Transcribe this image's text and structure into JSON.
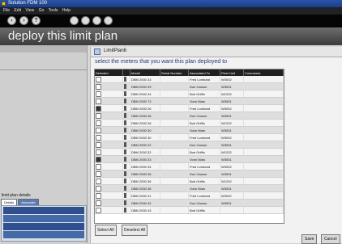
{
  "app": {
    "title": "Solution FDM 100"
  },
  "menu": {
    "items": [
      "File",
      "Edit",
      "View",
      "Go",
      "Tools",
      "Help"
    ]
  },
  "toolbar": {
    "buttons": [
      "back",
      "forward",
      "help",
      "b1",
      "b2",
      "b3",
      "b4"
    ]
  },
  "banner": {
    "title": "deploy this limit plan"
  },
  "dialog": {
    "title": "LimitPlan6",
    "instruction": "select the meters that you want this plan deployed to"
  },
  "table": {
    "headers": [
      "Selected",
      "",
      "Model",
      "Serial Number",
      "Associated To",
      "Fleet Unit",
      "Comments"
    ],
    "rows": [
      {
        "model": "DBM 2000 33",
        "serial": "",
        "assoc": "Fred Lombard",
        "fleet": "W3002",
        "checked": false
      },
      {
        "model": "DBM 2000 33",
        "serial": "",
        "assoc": "Don Carson",
        "fleet": "W3001",
        "checked": false
      },
      {
        "model": "DBM 2000 24",
        "serial": "",
        "assoc": "Bob Griffin",
        "fleet": "W1202",
        "checked": false
      },
      {
        "model": "DBM 2000 73",
        "serial": "",
        "assoc": "Vonn Mars",
        "fleet": "W3001",
        "checked": false
      },
      {
        "model": "DBM 2000 26",
        "serial": "",
        "assoc": "Fred Lombard",
        "fleet": "W3002",
        "checked": true
      },
      {
        "model": "DBM 2000 46",
        "serial": "",
        "assoc": "Don Carson",
        "fleet": "W3001",
        "checked": false
      },
      {
        "model": "DBM 2000 28",
        "serial": "",
        "assoc": "Bob Griffin",
        "fleet": "W1202",
        "checked": false
      },
      {
        "model": "DBM 2000 30",
        "serial": "",
        "assoc": "Vonn Mars",
        "fleet": "W3001",
        "checked": false
      },
      {
        "model": "DBM 2000 30",
        "serial": "",
        "assoc": "Fred Lombard",
        "fleet": "W3002",
        "checked": false
      },
      {
        "model": "DBM 2000 22",
        "serial": "",
        "assoc": "Don Carson",
        "fleet": "W3001",
        "checked": false
      },
      {
        "model": "DBM 2000 32",
        "serial": "",
        "assoc": "Bob Griffin",
        "fleet": "W1202",
        "checked": false
      },
      {
        "model": "DBM 2000 33",
        "serial": "",
        "assoc": "Vonn Mars",
        "fleet": "W3001",
        "checked": true
      },
      {
        "model": "DBM 2000 34",
        "serial": "",
        "assoc": "Fred Lombard",
        "fleet": "W3002",
        "checked": false
      },
      {
        "model": "DBM 2000 35",
        "serial": "",
        "assoc": "Don Carson",
        "fleet": "W3001",
        "checked": false
      },
      {
        "model": "DBM 2000 36",
        "serial": "",
        "assoc": "Bob Griffin",
        "fleet": "W1202",
        "checked": false
      },
      {
        "model": "DBM 2000 38",
        "serial": "",
        "assoc": "Vonn Mars",
        "fleet": "W3001",
        "checked": false
      },
      {
        "model": "DBM 2000 41",
        "serial": "",
        "assoc": "Fred Lombard",
        "fleet": "W3002",
        "checked": false
      },
      {
        "model": "DBM 2000 42",
        "serial": "",
        "assoc": "Don Carson",
        "fleet": "W3001",
        "checked": false
      },
      {
        "model": "DBM 2000 43",
        "serial": "",
        "assoc": "Bob Griffin",
        "fleet": "",
        "checked": false
      }
    ]
  },
  "buttons": {
    "select_all": "Select All",
    "deselect_all": "Deselect All",
    "save": "Save",
    "cancel": "Cancel"
  },
  "plan": {
    "title": "limit plan details",
    "tabs": [
      "Details",
      "Associate"
    ]
  }
}
